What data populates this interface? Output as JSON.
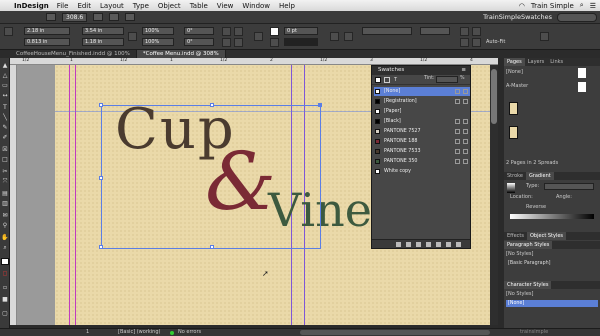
{
  "menubar": {
    "app": "InDesign",
    "items": [
      "File",
      "Edit",
      "Layout",
      "Type",
      "Object",
      "Table",
      "View",
      "Window",
      "Help"
    ],
    "time": "Train Simple"
  },
  "appbar": {
    "zoom": "308.6"
  },
  "workspace": "TrainSimpleSwatches",
  "control": {
    "x": "2.18 in",
    "y": "0.813 in",
    "w": "3.54 in",
    "h": "1.18 in",
    "scale_x": "100%",
    "scale_y": "100%",
    "rotate": "0°",
    "shear": "0°",
    "stroke_weight": "0 pt",
    "gutter_label": "Auto-Fit"
  },
  "tabs": [
    {
      "label": "CoffeeHouseMenu_Finished.indd @ 100%"
    },
    {
      "label": "*Coffee Menu.indd @ 308%"
    }
  ],
  "ruler_h": [
    "1/2",
    "1",
    "1/2",
    "1",
    "1/2",
    "2",
    "1/2",
    "3",
    "1/2",
    "4"
  ],
  "canvas": {
    "cup": "Cup",
    "amp": "&",
    "vine": "Vine"
  },
  "swatches": {
    "title": "Swatches",
    "tint_label": "Tint:",
    "tint_value": "%",
    "rows": [
      {
        "name": "[None]",
        "color": "#ffffff"
      },
      {
        "name": "[Registration]",
        "color": "#000000"
      },
      {
        "name": "[Paper]",
        "color": "#ffffff"
      },
      {
        "name": "[Black]",
        "color": "#000000"
      },
      {
        "name": "PANTONE 7527",
        "color": "#d6d0c4"
      },
      {
        "name": "PANTONE 188",
        "color": "#7a2a35"
      },
      {
        "name": "PANTONE 7533",
        "color": "#4a3b2f"
      },
      {
        "name": "PANTONE 350",
        "color": "#3d5a3f"
      },
      {
        "name": "White copy",
        "color": "#ffffff"
      }
    ]
  },
  "dock": {
    "tabs": [
      "Pages",
      "Layers",
      "Links"
    ],
    "none_label": "[None]",
    "master_label": "A-Master",
    "pages_info": "2 Pages in 2 Spreads",
    "stroke_tabs": [
      "Stroke",
      "Gradient"
    ],
    "type_label": "Type:",
    "location_label": "Location:",
    "angle_label": "Angle:",
    "reverse_label": "Reverse",
    "effects_tabs": [
      "Effects",
      "Object Styles"
    ],
    "paragraph_title": "Paragraph Styles",
    "no_styles": "[No Styles]",
    "basic_paragraph": "[Basic Paragraph]",
    "character_title": "Character Styles",
    "no_styles_2": "[No Styles]",
    "none_style": "[None]"
  },
  "status": {
    "page": "1",
    "style": "[Basic] (working)",
    "errors": "No errors"
  },
  "brand": "trainsimple"
}
